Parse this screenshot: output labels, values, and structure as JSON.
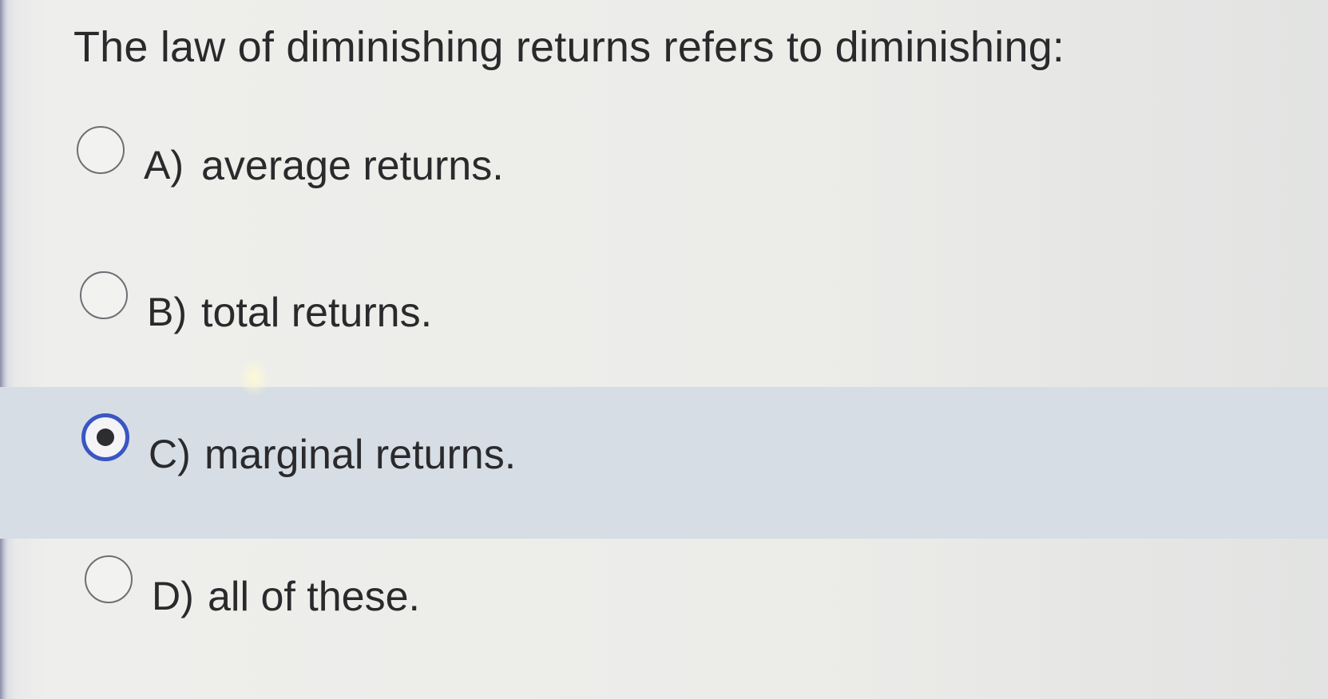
{
  "question": {
    "text": "The law of diminishing returns refers to diminishing:"
  },
  "options": [
    {
      "letter": "A)",
      "text": "average returns.",
      "selected": false
    },
    {
      "letter": "B)",
      "text": "total returns.",
      "selected": false
    },
    {
      "letter": "C)",
      "text": "marginal returns.",
      "selected": true
    },
    {
      "letter": "D)",
      "text": "all of these.",
      "selected": false
    }
  ],
  "colors": {
    "selected_row_bg": "#d6dde4",
    "radio_checked_ring": "#3a55c4",
    "text": "#2a2a2c"
  }
}
